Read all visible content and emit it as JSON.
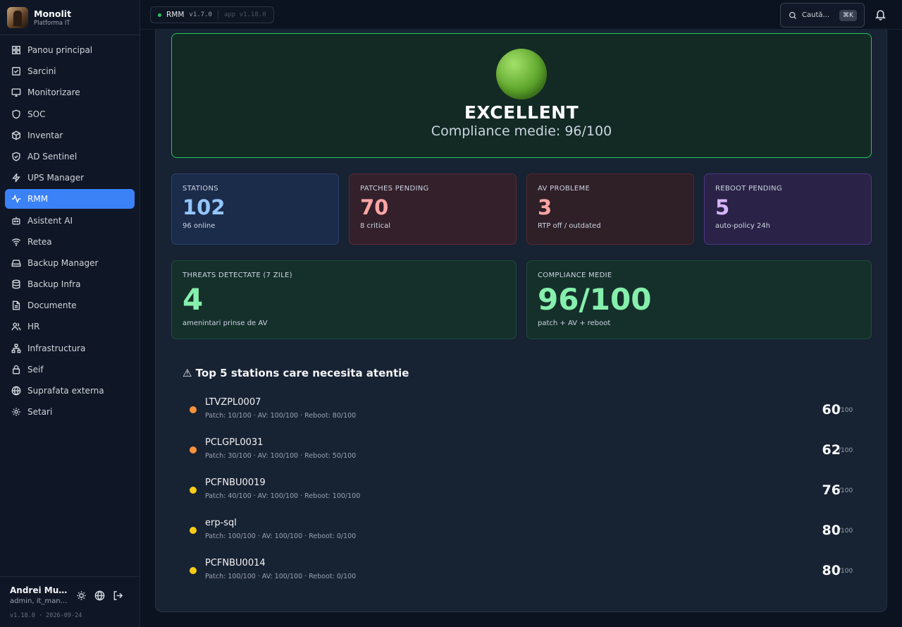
{
  "brand": {
    "name": "Monolit",
    "subtitle": "Platforma IT"
  },
  "sidebar": {
    "items": [
      {
        "label": "Panou principal",
        "icon": "dashboard-icon"
      },
      {
        "label": "Sarcini",
        "icon": "checkbox-icon"
      },
      {
        "label": "Monitorizare",
        "icon": "monitor-icon"
      },
      {
        "label": "SOC",
        "icon": "shield-icon"
      },
      {
        "label": "Inventar",
        "icon": "box-icon"
      },
      {
        "label": "AD Sentinel",
        "icon": "shield-check-icon"
      },
      {
        "label": "UPS Manager",
        "icon": "bolt-icon"
      },
      {
        "label": "RMM",
        "icon": "activity-icon",
        "active": true
      },
      {
        "label": "Asistent AI",
        "icon": "bot-icon"
      },
      {
        "label": "Retea",
        "icon": "wifi-icon"
      },
      {
        "label": "Backup Manager",
        "icon": "hard-drive-icon"
      },
      {
        "label": "Backup Infra",
        "icon": "database-icon"
      },
      {
        "label": "Documente",
        "icon": "document-icon"
      },
      {
        "label": "HR",
        "icon": "users-icon"
      },
      {
        "label": "Infrastructura",
        "icon": "network-icon"
      },
      {
        "label": "Seif",
        "icon": "lock-icon"
      },
      {
        "label": "Suprafata externa",
        "icon": "globe-icon"
      },
      {
        "label": "Setari",
        "icon": "gear-icon"
      }
    ],
    "user": {
      "name": "Andrei Munt...",
      "role": "admin, it_mana..."
    },
    "version": "v1.18.0 · 2026-09-24"
  },
  "topbar": {
    "module": "RMM",
    "module_version": "v1.7.0",
    "app_version": "app v1.18.0",
    "search_placeholder": "Caută...",
    "search_shortcut": "⌘K"
  },
  "hero": {
    "status": "EXCELLENT",
    "subtitle": "Compliance medie: 96/100",
    "status_color": "#22c55e"
  },
  "stats": {
    "stations": {
      "label": "STATIONS",
      "value": "102",
      "sub": "96 online",
      "color": "#93c5fd"
    },
    "patches": {
      "label": "PATCHES PENDING",
      "value": "70",
      "sub": "8 critical",
      "color": "#fca5a5"
    },
    "av": {
      "label": "AV PROBLEME",
      "value": "3",
      "sub": "RTP off / outdated",
      "color": "#fca5a5"
    },
    "reboot": {
      "label": "REBOOT PENDING",
      "value": "5",
      "sub": "auto-policy 24h",
      "color": "#d8b4fe"
    },
    "threats": {
      "label": "THREATS DETECTATE (7 ZILE)",
      "value": "4",
      "sub": "amenintari prinse de AV",
      "color": "#86efac"
    },
    "compliance": {
      "label": "COMPLIANCE MEDIE",
      "value": "96/100",
      "sub": "patch + AV + reboot",
      "color": "#86efac"
    }
  },
  "attention": {
    "title": "⚠ Top 5 stations care necesita atentie",
    "rows": [
      {
        "host": "LTVZPL0007",
        "details": "Patch: 10/100 · AV: 100/100 · Reboot: 80/100",
        "score": "60",
        "max": "/100",
        "color": "#fb923c"
      },
      {
        "host": "PCLGPL0031",
        "details": "Patch: 30/100 · AV: 100/100 · Reboot: 50/100",
        "score": "62",
        "max": "/100",
        "color": "#fb923c"
      },
      {
        "host": "PCFNBU0019",
        "details": "Patch: 40/100 · AV: 100/100 · Reboot: 100/100",
        "score": "76",
        "max": "/100",
        "color": "#facc15"
      },
      {
        "host": "erp-sql",
        "details": "Patch: 100/100 · AV: 100/100 · Reboot: 0/100",
        "score": "80",
        "max": "/100",
        "color": "#facc15"
      },
      {
        "host": "PCFNBU0014",
        "details": "Patch: 100/100 · AV: 100/100 · Reboot: 0/100",
        "score": "80",
        "max": "/100",
        "color": "#facc15"
      }
    ]
  }
}
